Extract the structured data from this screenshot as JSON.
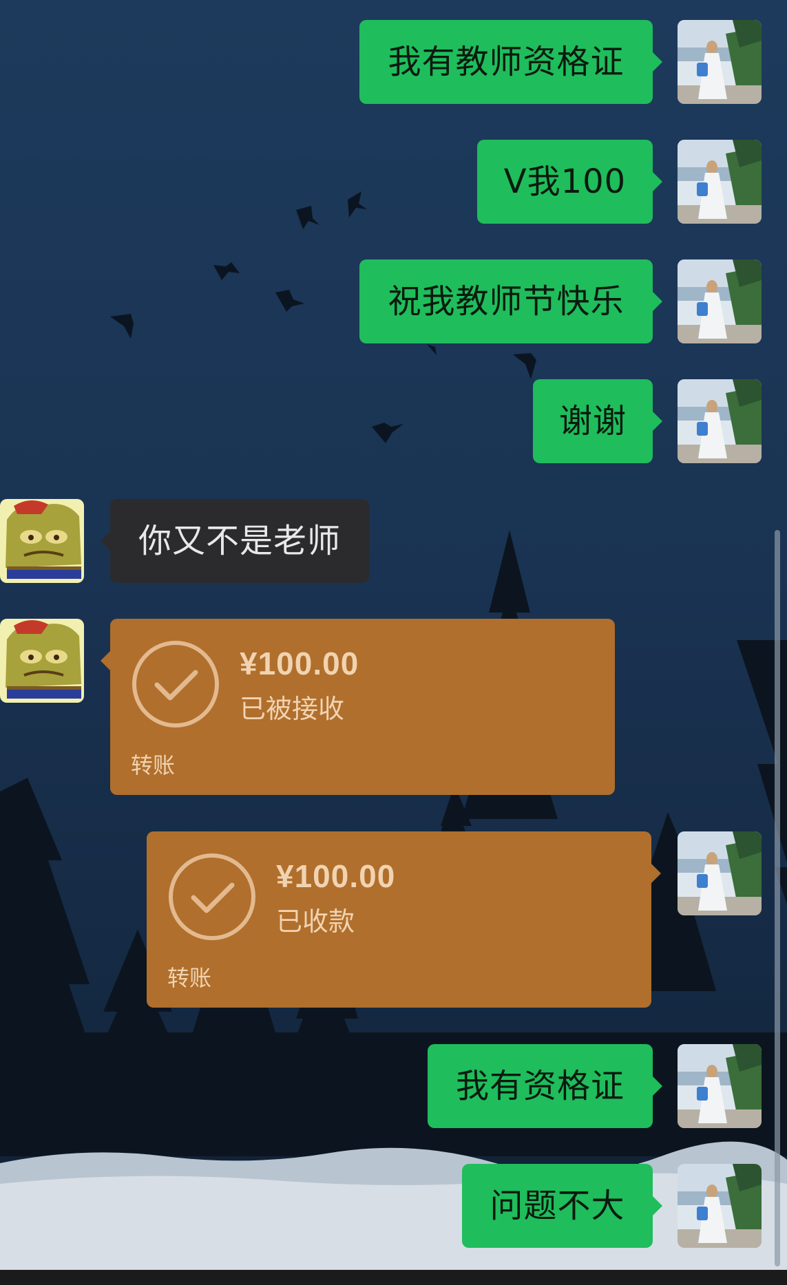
{
  "colors": {
    "sent_bubble": "#1fbd5c",
    "received_bubble": "#2b2b2d",
    "transfer_card": "#b06f2c",
    "transfer_text": "#f1d3b1"
  },
  "icons": {
    "my_avatar": "girl-by-sea-avatar",
    "other_avatar": "spongebob-meme-avatar",
    "transfer_status": "check-circle-icon"
  },
  "messages": [
    {
      "side": "me",
      "type": "text",
      "text": "我有教师资格证"
    },
    {
      "side": "me",
      "type": "text",
      "text": "V我100"
    },
    {
      "side": "me",
      "type": "text",
      "text": "祝我教师节快乐"
    },
    {
      "side": "me",
      "type": "text",
      "text": "谢谢"
    },
    {
      "side": "other",
      "type": "text",
      "text": "你又不是老师"
    },
    {
      "side": "other",
      "type": "transfer",
      "amount": "¥100.00",
      "status": "已被接收",
      "label": "转账"
    },
    {
      "side": "me",
      "type": "transfer",
      "amount": "¥100.00",
      "status": "已收款",
      "label": "转账"
    },
    {
      "side": "me",
      "type": "text",
      "text": "我有资格证"
    },
    {
      "side": "me",
      "type": "text",
      "text": "问题不大"
    }
  ]
}
